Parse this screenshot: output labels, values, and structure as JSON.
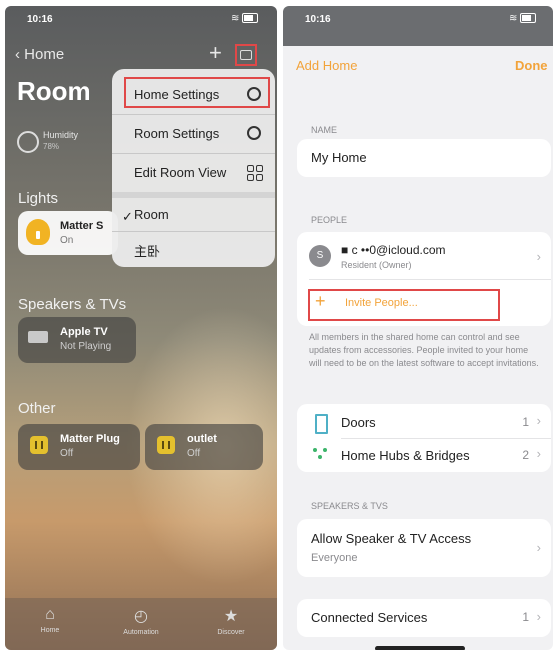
{
  "left": {
    "status_time": "10:16",
    "nav_back_label": "Home",
    "room_title": "Room",
    "humidity_label": "Humidity",
    "humidity_value": "78%",
    "sections": {
      "lights": "Lights",
      "speakers": "Speakers & TVs",
      "other": "Other"
    },
    "tiles": {
      "matter_bulb": {
        "name": "Matter S",
        "status": "On"
      },
      "apple_tv": {
        "name": "Apple TV",
        "status": "Not Playing"
      },
      "matter_plug": {
        "name": "Matter Plug",
        "status": "Off"
      },
      "outlet": {
        "name": "outlet",
        "status": "Off"
      }
    },
    "menu": {
      "home_settings": "Home Settings",
      "room_settings": "Room Settings",
      "edit_room_view": "Edit Room View",
      "room_option": "Room",
      "bedroom_option": "主卧",
      "check": "✓"
    },
    "tabbar": {
      "home": "Home",
      "automation": "Automation",
      "discover": "Discover"
    },
    "highlight_color": "#e04848"
  },
  "right": {
    "status_time": "10:16",
    "add_home": "Add Home",
    "done": "Done",
    "name_section": "NAME",
    "home_name": "My Home",
    "people_section": "PEOPLE",
    "person_initial": "S",
    "person_email": "■  c  ••0@icloud.com",
    "person_role": "Resident (Owner)",
    "invite_label": "Invite People...",
    "invite_plus": "+",
    "people_note": "All members in the shared home can control and see updates from accessories. People invited to your home will need to be on the latest software to accept invitations.",
    "doors_label": "Doors",
    "doors_count": "1",
    "hubs_label": "Home Hubs & Bridges",
    "hubs_count": "2",
    "speakers_section": "SPEAKERS & TVS",
    "speaker_access_label": "Allow Speaker & TV Access",
    "speaker_access_value": "Everyone",
    "connected_services": "Connected Services",
    "connected_count": "1",
    "accent_color": "#f2a33a"
  }
}
